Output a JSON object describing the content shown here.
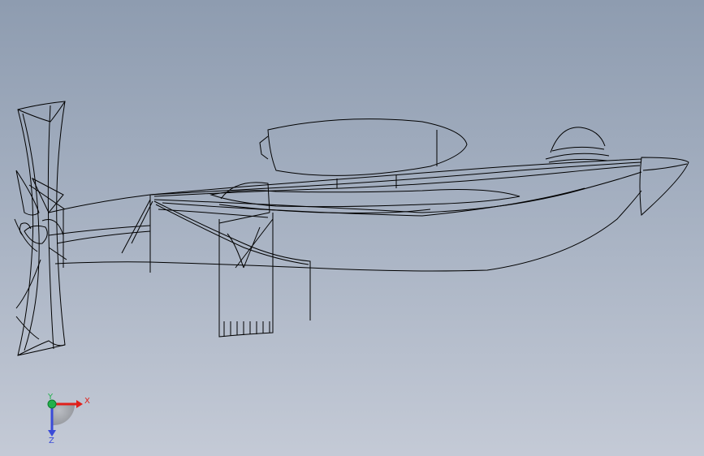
{
  "viewport": {
    "background_top": "#8e9cb0",
    "background_bottom": "#c4cad6",
    "line_color": "#000000"
  },
  "model": {
    "kind": "wireframe",
    "parts": [
      "propeller",
      "fuselage",
      "wing-float",
      "canopy",
      "nose-cone",
      "strut",
      "landing-gear"
    ]
  },
  "triad": {
    "x_label": "X",
    "y_label": "Y",
    "z_label": "Z",
    "x_color": "#e0201b",
    "y_color": "#22b14c",
    "z_color": "#3a4bd8"
  }
}
